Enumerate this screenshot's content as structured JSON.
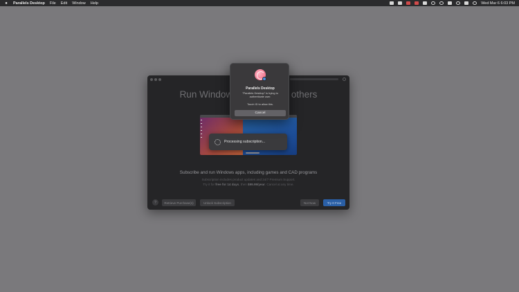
{
  "menubar": {
    "app_name": "Parallels Desktop",
    "menus": [
      "File",
      "Edit",
      "Window",
      "Help"
    ],
    "clock": "Wed Mar 6  6:03 PM"
  },
  "window": {
    "title": "Run Windows on Mac and others",
    "processing_text": "Processing subscription...",
    "subscribe_heading": "Subscribe and run Windows apps, including games and CAD programs",
    "fine_line1": "Subscription includes product updates and 24/7 Premium Support.",
    "fine_line2_pre": "Try it for ",
    "fine_line2_bold1": "free for 14 days",
    "fine_line2_mid": ", then ",
    "fine_line2_bold2": "$99.99/year",
    "fine_line2_post": ". Cancel at any time.",
    "help_label": "?",
    "buttons": {
      "retrieve": "Retrieve Purchase(s)",
      "unlock": "Unlock Subscription",
      "not_now": "Not Now",
      "try_free": "Try It Free"
    }
  },
  "auth_dialog": {
    "title": "Parallels Desktop",
    "message": "\"Parallels Desktop\" is trying to authenticate user.",
    "touch_id": "Touch ID to allow this.",
    "cancel": "Cancel"
  },
  "colors": {
    "desktop": "#7a797c",
    "accent": "#2a5fa6"
  }
}
